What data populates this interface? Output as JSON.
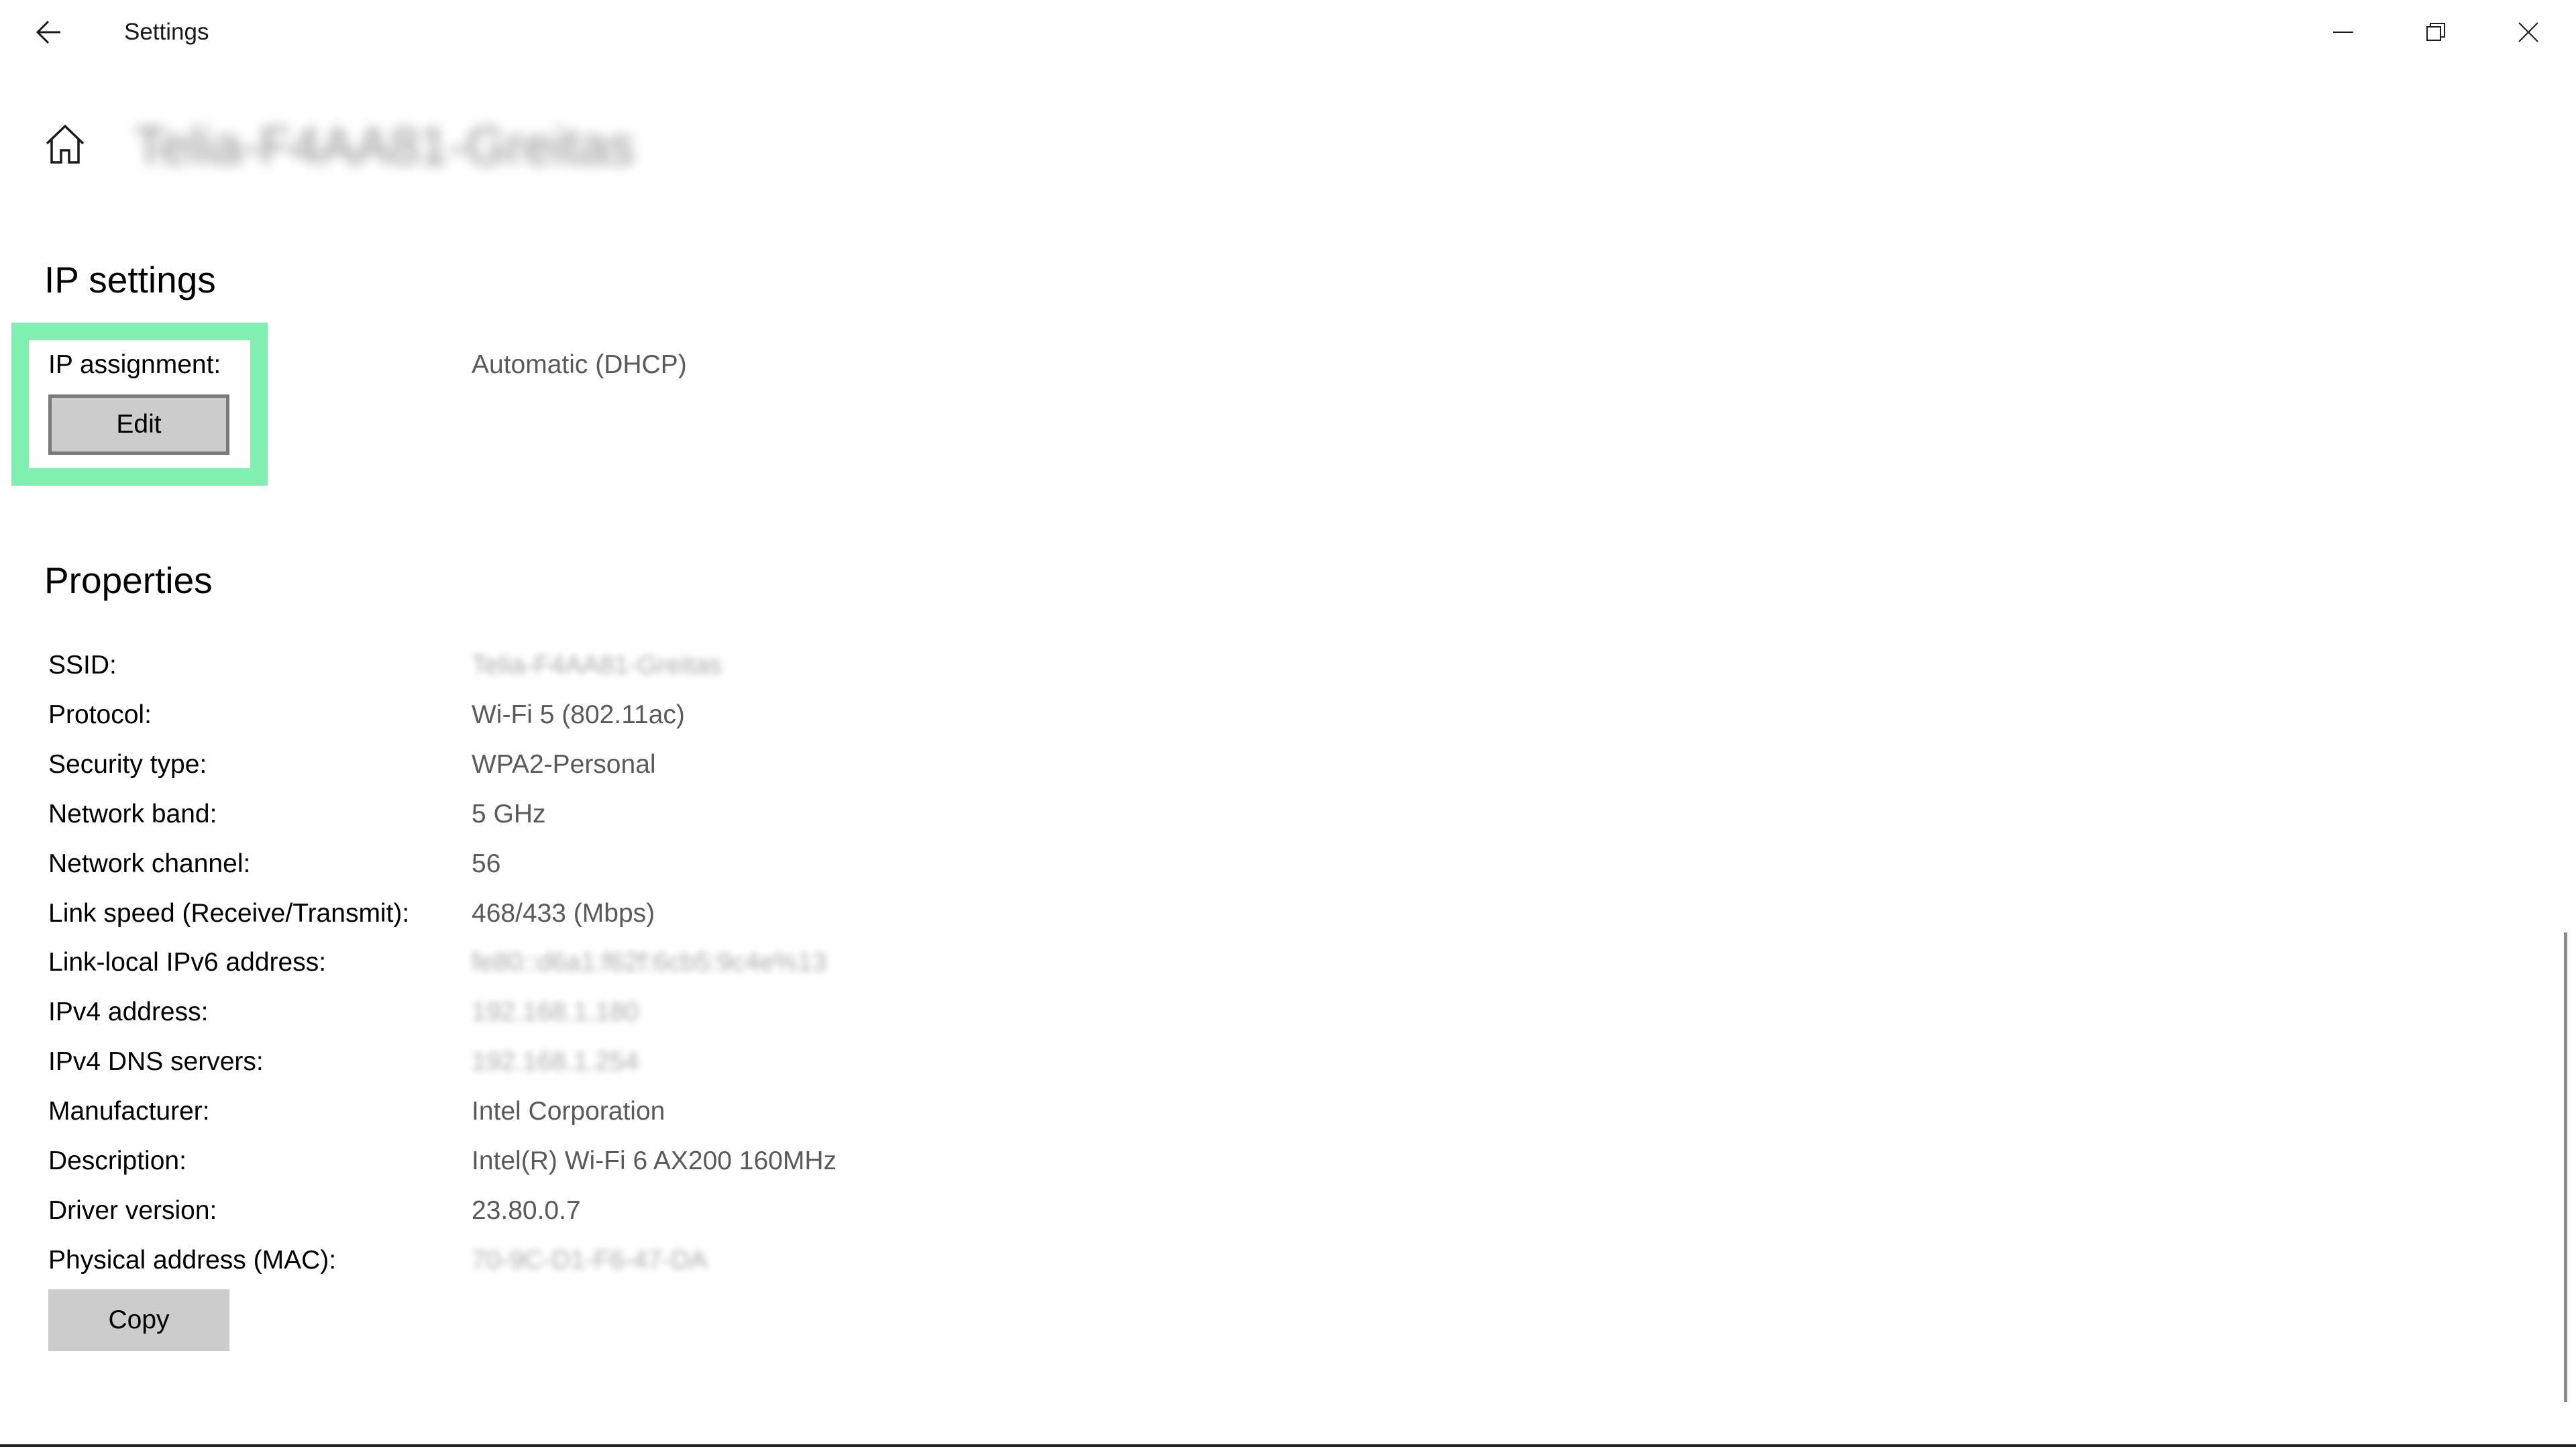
{
  "window": {
    "title": "Settings",
    "back_icon": "back-arrow-icon",
    "minimize_icon": "minimize-icon",
    "restore_icon": "restore-icon",
    "close_icon": "close-icon"
  },
  "header": {
    "home_icon": "home-icon",
    "network_name": "Telia-F4AA81-Greitas"
  },
  "ip_settings": {
    "title": "IP settings",
    "assignment_label": "IP assignment:",
    "assignment_value": "Automatic (DHCP)",
    "edit_label": "Edit",
    "highlight_color": "#7ff0b0"
  },
  "properties": {
    "title": "Properties",
    "rows": [
      {
        "label": "SSID:",
        "value": "Telia-F4AA81-Greitas"
      },
      {
        "label": "Protocol:",
        "value": "Wi-Fi 5 (802.11ac)"
      },
      {
        "label": "Security type:",
        "value": "WPA2-Personal"
      },
      {
        "label": "Network band:",
        "value": "5 GHz"
      },
      {
        "label": "Network channel:",
        "value": "56"
      },
      {
        "label": "Link speed (Receive/Transmit):",
        "value": "468/433 (Mbps)"
      },
      {
        "label": "Link-local IPv6 address:",
        "value": "fe80::d6a1:f62f:6cb5:9c4e%13"
      },
      {
        "label": "IPv4 address:",
        "value": "192.168.1.180"
      },
      {
        "label": "IPv4 DNS servers:",
        "value": "192.168.1.254"
      },
      {
        "label": "Manufacturer:",
        "value": "Intel Corporation"
      },
      {
        "label": "Description:",
        "value": "Intel(R) Wi-Fi 6 AX200 160MHz"
      },
      {
        "label": "Driver version:",
        "value": "23.80.0.7"
      },
      {
        "label": "Physical address (MAC):",
        "value": "70-9C-D1-F6-47-DA"
      }
    ],
    "copy_label": "Copy"
  }
}
